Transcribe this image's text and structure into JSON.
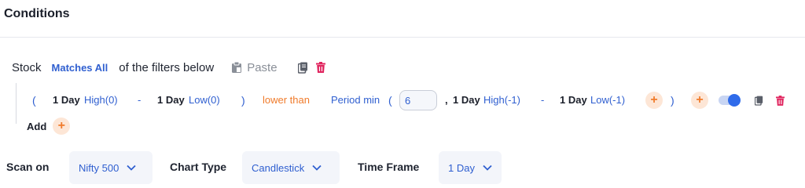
{
  "header": {
    "title": "Conditions"
  },
  "stock_row": {
    "label": "Stock",
    "matches": "Matches All",
    "suffix": "of the filters below",
    "paste_label": "Paste"
  },
  "condition": {
    "open_paren": "(",
    "lhs_a_tf": "1 Day",
    "lhs_a_field": "High(0)",
    "minus1": "-",
    "lhs_b_tf": "1 Day",
    "lhs_b_field": "Low(0)",
    "close_paren1": ")",
    "operator": "lower than",
    "func": "Period min",
    "open_paren2": "(",
    "period_value": "6",
    "comma": ",",
    "rhs_a_tf": "1 Day",
    "rhs_a_field": "High(-1)",
    "minus2": "-",
    "rhs_b_tf": "1 Day",
    "rhs_b_field": "Low(-1)",
    "close_paren2": ")",
    "plus_symbol": "+",
    "enabled": true
  },
  "add": {
    "label": "Add",
    "plus_symbol": "+"
  },
  "bottom": {
    "scan_on_label": "Scan on",
    "scan_on_value": "Nifty 500",
    "chart_type_label": "Chart Type",
    "chart_type_value": "Candlestick",
    "time_frame_label": "Time Frame",
    "time_frame_value": "1 Day"
  },
  "colors": {
    "accent_blue": "#2f5fd0",
    "accent_orange": "#f07b2b",
    "delete_red": "#e0245e"
  },
  "icons": [
    "clipboard-icon",
    "copy-icon",
    "trash-icon",
    "chevron-down-icon"
  ]
}
